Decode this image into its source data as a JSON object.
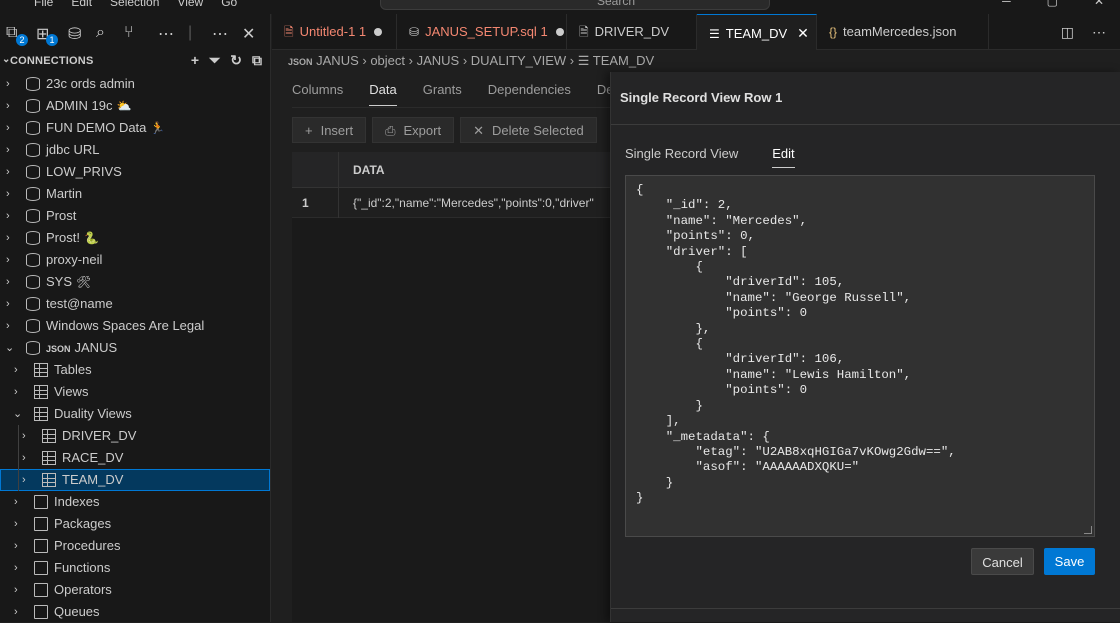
{
  "titlebar": {
    "menu": [
      "File",
      "Edit",
      "Selection",
      "View",
      "Go"
    ],
    "search_placeholder": "Search"
  },
  "activity": {
    "badge_1": "2",
    "badge_2": "1"
  },
  "sidebar": {
    "header": "CONNECTIONS",
    "connections": [
      {
        "label": "23c ords admin",
        "emoji": ""
      },
      {
        "label": "ADMIN 19c",
        "emoji": "⛅"
      },
      {
        "label": "FUN DEMO Data",
        "emoji": "🏃"
      },
      {
        "label": "jdbc URL",
        "emoji": ""
      },
      {
        "label": "LOW_PRIVS",
        "emoji": ""
      },
      {
        "label": "Martin",
        "emoji": ""
      },
      {
        "label": "Prost",
        "emoji": ""
      },
      {
        "label": "Prost!",
        "emoji": "🐍"
      },
      {
        "label": "proxy-neil",
        "emoji": ""
      },
      {
        "label": "SYS",
        "emoji": "🛠"
      },
      {
        "label": "test@name",
        "emoji": ""
      },
      {
        "label": "Windows Spaces Are Legal",
        "emoji": ""
      }
    ],
    "janus": {
      "prefix": "JSON",
      "label": "JANUS"
    },
    "janus_children": {
      "tables": "Tables",
      "views": "Views",
      "duality_views": "Duality Views",
      "dv_items": [
        "DRIVER_DV",
        "RACE_DV",
        "TEAM_DV"
      ],
      "rest": [
        "Indexes",
        "Packages",
        "Procedures",
        "Functions",
        "Operators",
        "Queues"
      ]
    }
  },
  "tabs": [
    {
      "label": "Untitled-1",
      "suffix": "1",
      "color": "#f48771"
    },
    {
      "label": "JANUS_SETUP.sql",
      "suffix": "1",
      "color": "#f48771"
    },
    {
      "label": "DRIVER_DV",
      "suffix": "",
      "color": "#cccccc"
    },
    {
      "label": "TEAM_DV",
      "suffix": "",
      "color": "#ffffff"
    },
    {
      "label": "teamMercedes.json",
      "suffix": "",
      "color": "#cccccc"
    }
  ],
  "breadcrumb": {
    "prefix": "JSON",
    "parts": [
      "JANUS",
      "object",
      "JANUS",
      "DUALITY_VIEW",
      "TEAM_DV"
    ]
  },
  "subtabs": [
    "Columns",
    "Data",
    "Grants",
    "Dependencies",
    "De"
  ],
  "toolbar": {
    "insert": "Insert",
    "export": "Export",
    "delete_selected": "Delete Selected"
  },
  "grid": {
    "column": "DATA",
    "rows": [
      {
        "num": "1",
        "data": "{\"_id\":2,\"name\":\"Mercedes\",\"points\":0,\"driver\""
      }
    ]
  },
  "panel": {
    "title": "Single Record View Row 1",
    "tabs": [
      "Single Record View",
      "Edit"
    ],
    "json_text": "{\n    \"_id\": 2,\n    \"name\": \"Mercedes\",\n    \"points\": 0,\n    \"driver\": [\n        {\n            \"driverId\": 105,\n            \"name\": \"George Russell\",\n            \"points\": 0\n        },\n        {\n            \"driverId\": 106,\n            \"name\": \"Lewis Hamilton\",\n            \"points\": 0\n        }\n    ],\n    \"_metadata\": {\n        \"etag\": \"U2AB8xqHGIGa7vKOwg2Gdw==\",\n        \"asof\": \"AAAAAADXQKU=\"\n    }\n}",
    "cancel": "Cancel",
    "save": "Save"
  }
}
